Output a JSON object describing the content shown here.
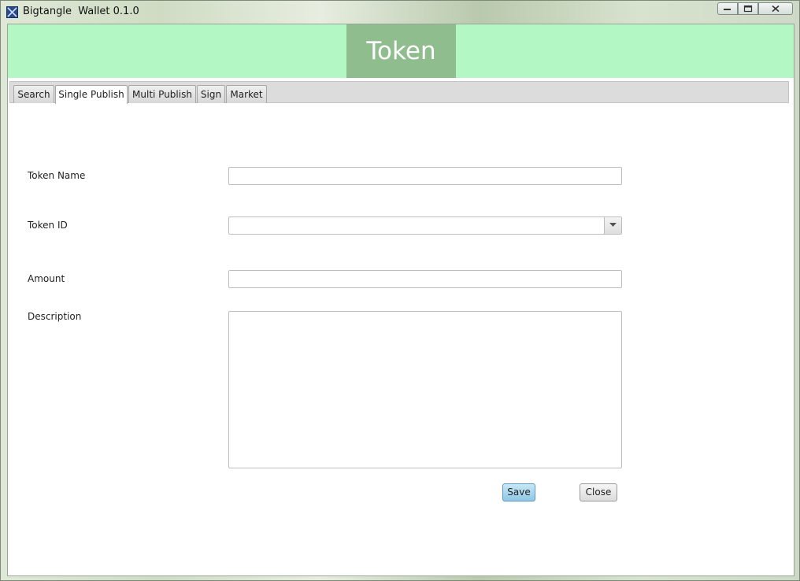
{
  "window": {
    "title": "Bigtangle  Wallet 0.1.0",
    "app_icon": "app-x-icon",
    "controls": [
      "minimize-icon",
      "maximize-icon",
      "close-icon"
    ]
  },
  "header": {
    "title": "Token",
    "band_color": "#b3f7c4",
    "title_bg_color": "#8fbd8e"
  },
  "tabs": [
    {
      "label": "Search",
      "active": false
    },
    {
      "label": "Single Publish",
      "active": true
    },
    {
      "label": "Multi Publish",
      "active": false
    },
    {
      "label": "Sign",
      "active": false
    },
    {
      "label": "Market",
      "active": false
    }
  ],
  "form": {
    "token_name": {
      "label": "Token Name",
      "value": "",
      "placeholder": ""
    },
    "token_id": {
      "label": "Token ID",
      "value": ""
    },
    "amount": {
      "label": "Amount",
      "value": "",
      "placeholder": ""
    },
    "description": {
      "label": "Description",
      "value": ""
    }
  },
  "buttons": {
    "save": "Save",
    "close": "Close",
    "accent_color": "#8ec7e6"
  }
}
